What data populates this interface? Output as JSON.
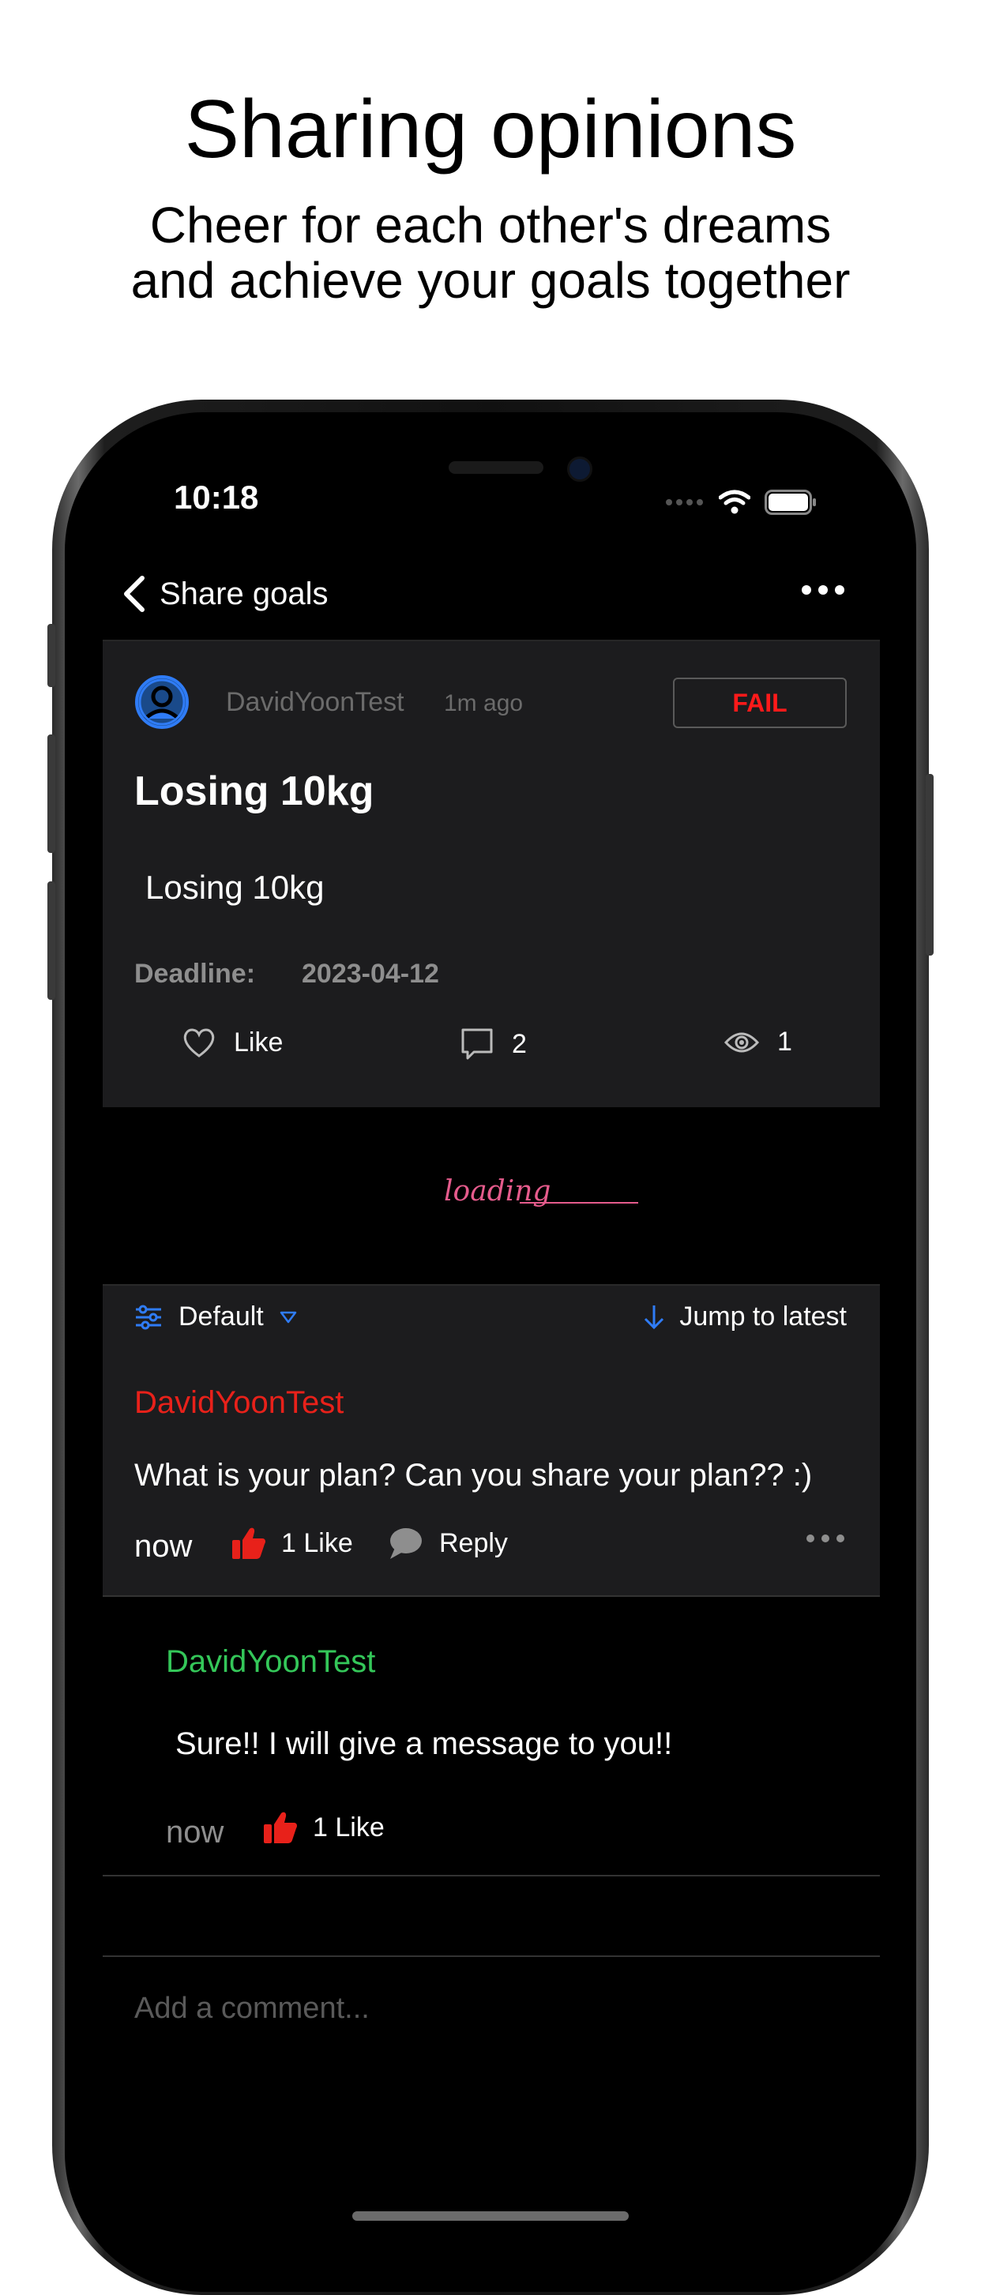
{
  "promo": {
    "title": "Sharing opinions",
    "subtitle_line1": "Cheer for each other's dreams",
    "subtitle_line2": "and achieve your goals together"
  },
  "status_bar": {
    "time": "10:18"
  },
  "nav": {
    "title": "Share goals"
  },
  "post": {
    "username": "DavidYoonTest",
    "time_ago": "1m ago",
    "status_badge": "FAIL",
    "title": "Losing 10kg",
    "body": "Losing 10kg",
    "deadline_label": "Deadline:",
    "deadline_value": "2023-04-12",
    "like_label": "Like",
    "comment_count": "2",
    "view_count": "1"
  },
  "loading": {
    "text": "loading"
  },
  "sort_bar": {
    "sort_label": "Default",
    "jump_label": "Jump to latest"
  },
  "comments": [
    {
      "username": "DavidYoonTest",
      "text": "What is your plan? Can you share your plan?? :)",
      "time": "now",
      "likes": "1 Like",
      "reply_label": "Reply"
    }
  ],
  "replies": [
    {
      "username": "DavidYoonTest",
      "text": "Sure!! I will give a message to you!!",
      "time": "now",
      "likes": "1 Like"
    }
  ],
  "input": {
    "placeholder": "Add a comment..."
  },
  "colors": {
    "fail": "#ff1a1a",
    "comment_user": "#e8211a",
    "reply_user": "#34c759",
    "accent_blue": "#2f7cf6",
    "loading_pink": "#e55b8c"
  }
}
